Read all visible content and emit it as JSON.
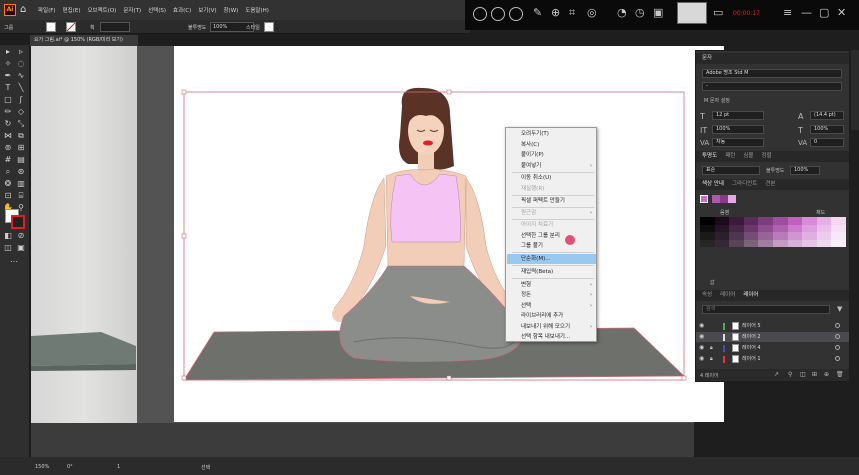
{
  "app": {
    "logo": "Ai",
    "menus": [
      "파일(F)",
      "편집(E)",
      "오브젝트(O)",
      "문자(T)",
      "선택(S)",
      "효과(C)",
      "보기(V)",
      "창(W)",
      "도움말(H)"
    ]
  },
  "recorder": {
    "time": "00:00:17"
  },
  "controlbar": {
    "selection_label": "그룹",
    "stroke_label": "획",
    "opacity_label": "불투명도",
    "opacity_value": "100%",
    "style_label": "스타일"
  },
  "document": {
    "tab_title": "요가 그림.ai* @ 150% (RGB/미리 보기)"
  },
  "context_menu": {
    "items": [
      {
        "label": "오려두기(T)",
        "disabled": false,
        "submenu": false
      },
      {
        "label": "복사(C)",
        "disabled": false,
        "submenu": false
      },
      {
        "label": "붙이기(P)",
        "disabled": false,
        "submenu": false
      },
      {
        "label": "붙여넣기",
        "disabled": false,
        "submenu": true
      },
      {
        "label": "이동 취소(U)",
        "disabled": false,
        "submenu": false
      },
      {
        "label": "재실행(R)",
        "disabled": true,
        "submenu": false
      },
      {
        "label": "픽셀 퍼펙트 만들기",
        "disabled": false,
        "submenu": false
      },
      {
        "label": "원근감",
        "disabled": true,
        "submenu": true
      },
      {
        "label": "아이지 치료기",
        "disabled": true,
        "submenu": false
      },
      {
        "label": "선택한 그룹 분리",
        "disabled": false,
        "submenu": false
      },
      {
        "label": "그룹 풀기",
        "disabled": false,
        "submenu": false
      },
      {
        "label": "단순화(M)...",
        "disabled": false,
        "submenu": false,
        "highlighted": true
      },
      {
        "label": "재입력(Beta)",
        "disabled": false,
        "submenu": false
      },
      {
        "label": "변형",
        "disabled": false,
        "submenu": true
      },
      {
        "label": "정돈",
        "disabled": false,
        "submenu": true
      },
      {
        "label": "선택",
        "disabled": false,
        "submenu": true
      },
      {
        "label": "라이브러리에 추가",
        "disabled": false,
        "submenu": false
      },
      {
        "label": "내보내기 위해 모으기",
        "disabled": false,
        "submenu": true
      },
      {
        "label": "선택 항목 내보내기...",
        "disabled": false,
        "submenu": false
      }
    ]
  },
  "character_panel": {
    "title": "문자",
    "font": "Adobe 명조 Std M",
    "style": "-",
    "size": "12 pt",
    "leading": "(14.4 pt)",
    "scale_v": "100%",
    "scale_h": "100%",
    "tracking": "0",
    "kerning": "자동",
    "wordspace_label": "M 문자 설정"
  },
  "para_tabs": [
    "투명도",
    "패턴",
    "심볼",
    "정렬"
  ],
  "transparency": {
    "mode": "표준",
    "opacity": "100%"
  },
  "color_guide": {
    "tabs": [
      "색상 안내",
      "그라디언트",
      "견본"
    ],
    "labels": [
      "음영",
      "채도"
    ],
    "bottom_label": "값",
    "swatch_colors": [
      "#c86dc8",
      "#a95aa9",
      "#8a3a8a",
      "#e7a6e7"
    ],
    "grid_colors": [
      [
        "#000000",
        "#1a0a1a",
        "#3b1a3b",
        "#5c2b5c",
        "#7d3c7d",
        "#9f4e9f",
        "#c060c0",
        "#d98ad9",
        "#e6b0e6",
        "#f2d6f2"
      ],
      [
        "#0d0d0d",
        "#241424",
        "#472747",
        "#693a69",
        "#8c4e8c",
        "#ae62ae",
        "#cc7ccc",
        "#dd9edd",
        "#eabfea",
        "#f5e0f5"
      ],
      [
        "#1a1a1a",
        "#2b1f2b",
        "#4f364f",
        "#734d73",
        "#976497",
        "#b97bb9",
        "#d096d0",
        "#dfb0df",
        "#ecccec",
        "#f7e8f7"
      ],
      [
        "#262626",
        "#332833",
        "#574557",
        "#7b627b",
        "#9f7f9f",
        "#c39cc3",
        "#d6b0d6",
        "#e3c4e3",
        "#eed8ee",
        "#f8eef8"
      ]
    ]
  },
  "layers_panel": {
    "tabs": [
      "속성",
      "레이어",
      "레이어"
    ],
    "search_placeholder": "검색",
    "layers": [
      {
        "name": "레이어 5",
        "color": "#4caf50",
        "selected": false,
        "locked": false
      },
      {
        "name": "레이어 2",
        "color": "#e0e0e0",
        "selected": true,
        "locked": false
      },
      {
        "name": "레이어 4",
        "color": "#3f51b5",
        "selected": false,
        "locked": true
      },
      {
        "name": "레이어 1",
        "color": "#e53935",
        "selected": false,
        "locked": true
      }
    ],
    "count_label": "4 레이어"
  },
  "status": {
    "zoom": "150%",
    "rotation": "0°",
    "page": "1",
    "tool": "선택"
  }
}
